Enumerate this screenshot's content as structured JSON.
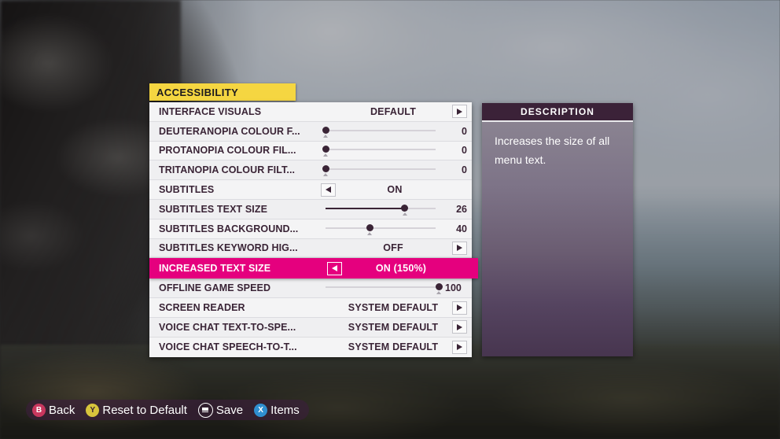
{
  "category": {
    "title": "ACCESSIBILITY"
  },
  "settings": {
    "rows": [
      {
        "label": "INTERFACE VISUALS",
        "type": "option",
        "value": "DEFAULT",
        "left_arrow": false,
        "right_arrow": true,
        "selected": false
      },
      {
        "label": "DEUTERANOPIA COLOUR F...",
        "type": "slider",
        "value": "0",
        "fill_percent": 0,
        "default_percent": 0,
        "selected": false
      },
      {
        "label": "PROTANOPIA COLOUR FIL...",
        "type": "slider",
        "value": "0",
        "fill_percent": 0,
        "default_percent": 0,
        "selected": false
      },
      {
        "label": "TRITANOPIA COLOUR FILT...",
        "type": "slider",
        "value": "0",
        "fill_percent": 0,
        "default_percent": 0,
        "selected": false
      },
      {
        "label": "SUBTITLES",
        "type": "option",
        "value": "ON",
        "left_arrow": true,
        "right_arrow": false,
        "selected": false
      },
      {
        "label": "SUBTITLES TEXT SIZE",
        "type": "slider",
        "value": "26",
        "fill_percent": 72,
        "default_percent": 0,
        "selected": false
      },
      {
        "label": "SUBTITLES BACKGROUND...",
        "type": "slider",
        "value": "40",
        "fill_percent": 0,
        "default_percent": 40,
        "selected": false
      },
      {
        "label": "SUBTITLES KEYWORD HIG...",
        "type": "option",
        "value": "OFF",
        "left_arrow": false,
        "right_arrow": true,
        "selected": false
      },
      {
        "label": "INCREASED TEXT SIZE",
        "type": "option",
        "value": "ON (150%)",
        "left_arrow": true,
        "right_arrow": false,
        "selected": true
      },
      {
        "label": "OFFLINE GAME SPEED",
        "type": "slider",
        "value": "100",
        "fill_percent": 0,
        "default_percent": 100,
        "inline_value": true,
        "selected": false
      },
      {
        "label": "SCREEN READER",
        "type": "option",
        "value": "SYSTEM DEFAULT",
        "left_arrow": false,
        "right_arrow": true,
        "selected": false
      },
      {
        "label": "VOICE CHAT TEXT-TO-SPE...",
        "type": "option",
        "value": "SYSTEM DEFAULT",
        "left_arrow": false,
        "right_arrow": true,
        "selected": false
      },
      {
        "label": "VOICE CHAT SPEECH-TO-T...",
        "type": "option",
        "value": "SYSTEM DEFAULT",
        "left_arrow": false,
        "right_arrow": true,
        "selected": false
      }
    ]
  },
  "description": {
    "header": "DESCRIPTION",
    "text": "Increases the size of all menu text."
  },
  "button_bar": {
    "buttons": [
      {
        "glyph": "B",
        "icon": "b-button-icon",
        "label": "Back",
        "style": "b-btn"
      },
      {
        "glyph": "Y",
        "icon": "y-button-icon",
        "label": "Reset to Default",
        "style": "y-btn"
      },
      {
        "glyph": "",
        "icon": "menu-button-icon",
        "label": "Save",
        "style": "menu-btn"
      },
      {
        "glyph": "X",
        "icon": "x-button-icon",
        "label": "Items",
        "style": "x-btn"
      }
    ]
  },
  "colors": {
    "accent_highlight": "#e5007e",
    "category_tab": "#f5d641",
    "text_dark": "#3a2436",
    "description_header": "#3b2238"
  }
}
